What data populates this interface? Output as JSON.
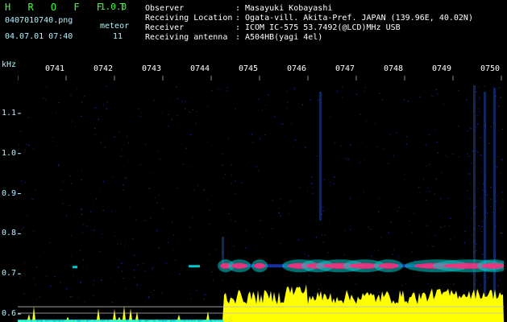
{
  "header": {
    "app_name": "H R O F F T",
    "version": "1.0.0",
    "filename": "0407010740.png",
    "meteor_label": "meteor",
    "meteor_count": "11",
    "datetime": "04.07.01 07:40"
  },
  "info": [
    {
      "key": "Observer",
      "value": "Masayuki Kobayashi"
    },
    {
      "key": "Receiving Location",
      "value": "Ogata-vill. Akita-Pref. JAPAN (139.96E, 40.02N)"
    },
    {
      "key": "Receiver",
      "value": "ICOM IC-575 53.7492(@LCD)MHz USB"
    },
    {
      "key": "Receiving antenna",
      "value": "A504HB(yagi 4el)"
    }
  ],
  "info_separator": ":",
  "chart_data": {
    "type": "heatmap",
    "ylabel": "kHz",
    "yticks": [
      "1.1",
      "1.0",
      "0.9",
      "0.8",
      "0.7",
      "0.6"
    ],
    "ytick_values": [
      1.1,
      1.0,
      0.9,
      0.8,
      0.7,
      0.6
    ],
    "ylim": [
      0.58,
      1.17
    ],
    "xticks": [
      "0741",
      "0742",
      "0743",
      "0744",
      "0745",
      "0746",
      "0747",
      "0748",
      "0749",
      "0750"
    ],
    "x_range_minutes": [
      0,
      10
    ],
    "signal_center_khz": 0.72,
    "colors": {
      "background": "#000000",
      "noise": "#1e3cc8",
      "echo_mid": "#00c8c8",
      "echo_high": "#ff2a7a",
      "echo_peak": "#ffff00",
      "histogram": "#ffff00",
      "histogram_low": "#00ffff"
    }
  }
}
